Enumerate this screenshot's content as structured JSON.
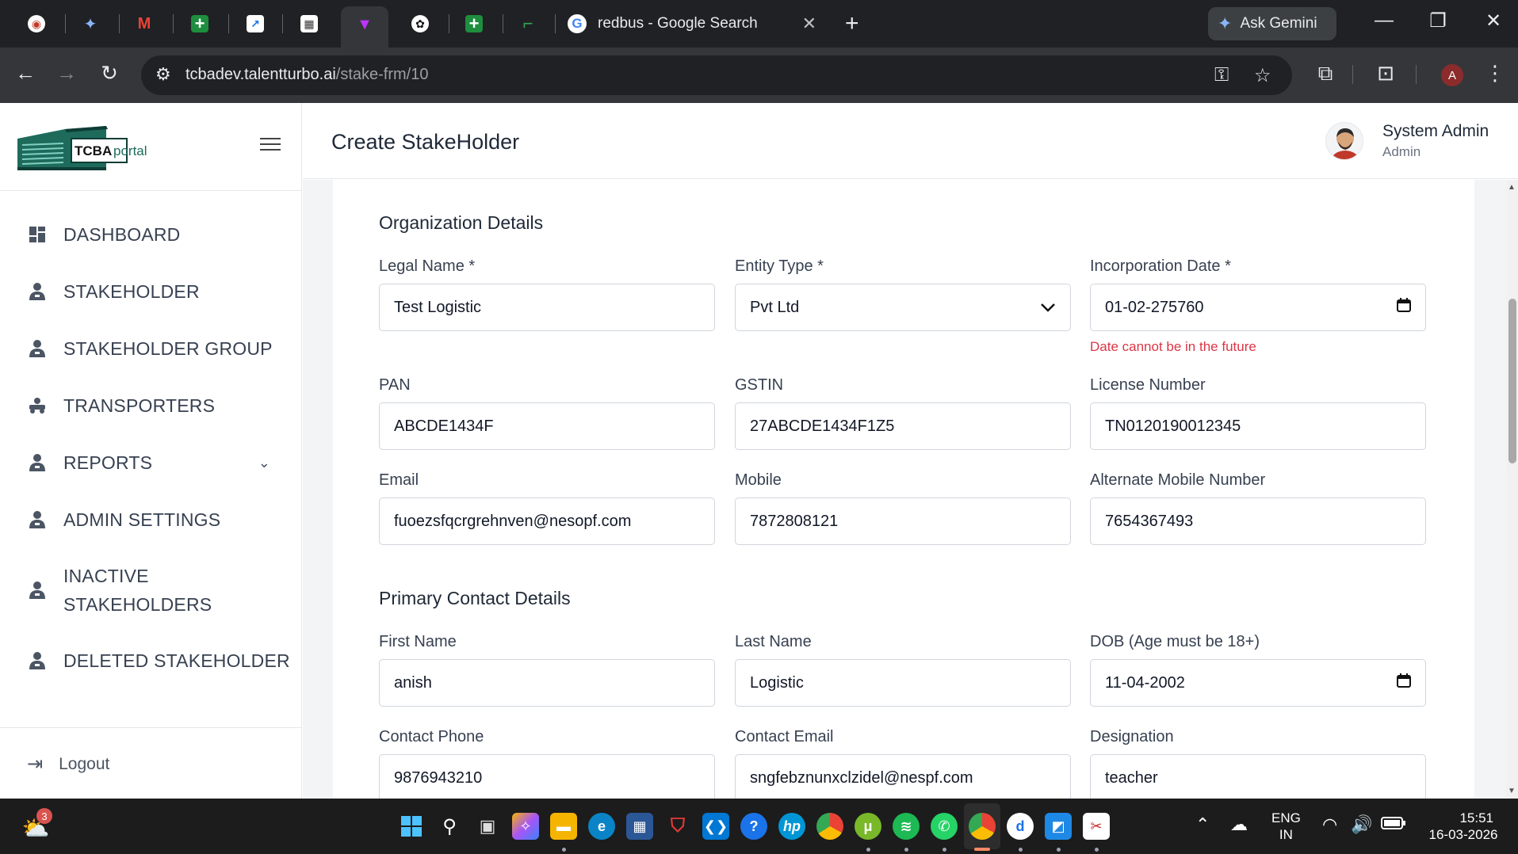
{
  "browser": {
    "tabs": [
      {
        "icon": "chrome-app-icon"
      },
      {
        "icon": "gemini-icon"
      },
      {
        "icon": "gmail-icon"
      },
      {
        "icon": "sheets-plus-icon"
      },
      {
        "icon": "chart-app-icon"
      },
      {
        "icon": "building-app-icon"
      },
      {
        "icon": "vite-icon"
      },
      {
        "icon": "openai-icon"
      },
      {
        "icon": "sheets-plus-icon"
      },
      {
        "icon": "green-app-icon"
      }
    ],
    "active_tab_title": "redbus - Google Search",
    "ask_gemini": "Ask Gemini",
    "url_host": "tcbadev.talentturbo.ai",
    "url_path": "/stake-frm/10",
    "profile_initial": "A"
  },
  "sidebar": {
    "logo_text_a": "TCBA",
    "logo_text_b": "portal",
    "items": [
      {
        "label": "DASHBOARD",
        "icon": "dashboard-icon"
      },
      {
        "label": "STAKEHOLDER",
        "icon": "user-icon"
      },
      {
        "label": "STAKEHOLDER GROUP",
        "icon": "user-icon"
      },
      {
        "label": "TRANSPORTERS",
        "icon": "transporter-icon"
      },
      {
        "label": "REPORTS",
        "icon": "user-icon"
      },
      {
        "label": "ADMIN SETTINGS",
        "icon": "user-icon"
      },
      {
        "label": "INACTIVE STAKEHOLDERS",
        "icon": "user-icon"
      },
      {
        "label": "DELETED STAKEHOLDER",
        "icon": "user-icon"
      }
    ],
    "logout": "Logout"
  },
  "header": {
    "title": "Create StakeHolder",
    "user_name": "System Admin",
    "user_role": "Admin"
  },
  "form": {
    "org_title": "Organization Details",
    "legal_name": {
      "label": "Legal Name *",
      "value": "Test Logistic"
    },
    "entity_type": {
      "label": "Entity Type *",
      "value": "Pvt Ltd"
    },
    "incorporation_date": {
      "label": "Incorporation Date *",
      "value": "01-02-275760",
      "error": "Date cannot be in the future"
    },
    "pan": {
      "label": "PAN",
      "value": "ABCDE1434F"
    },
    "gstin": {
      "label": "GSTIN",
      "value": "27ABCDE1434F1Z5"
    },
    "license": {
      "label": "License Number",
      "value": "TN0120190012345"
    },
    "email": {
      "label": "Email",
      "value": "fuoezsfqcrgrehnven@nesopf.com"
    },
    "mobile": {
      "label": "Mobile",
      "value": "7872808121"
    },
    "alt_mobile": {
      "label": "Alternate Mobile Number",
      "value": "7654367493"
    },
    "contact_title": "Primary Contact Details",
    "first_name": {
      "label": "First Name",
      "value": "anish"
    },
    "last_name": {
      "label": "Last Name",
      "value": "Logistic"
    },
    "dob": {
      "label": "DOB (Age must be 18+)",
      "value": "11-04-2002"
    },
    "contact_phone": {
      "label": "Contact Phone",
      "value": "9876943210"
    },
    "contact_email": {
      "label": "Contact Email",
      "value": "sngfebznunxclzidel@nespf.com"
    },
    "designation": {
      "label": "Designation",
      "value": "teacher"
    }
  },
  "taskbar": {
    "weather_badge": "3",
    "lang_a": "ENG",
    "lang_b": "IN",
    "time": "15:51",
    "date": "16-03-2026"
  },
  "colors": {
    "accent": "#1e6b5c",
    "error": "#dc3545",
    "chrome_dark": "#202124"
  }
}
